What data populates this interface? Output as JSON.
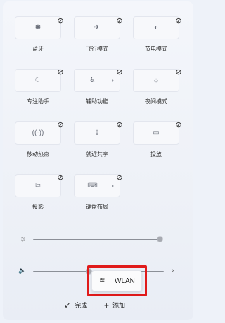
{
  "tiles": [
    {
      "label": "蓝牙",
      "icon": "bluetooth-icon",
      "glyph": "✱"
    },
    {
      "label": "飞行模式",
      "icon": "airplane-icon",
      "glyph": "✈"
    },
    {
      "label": "节电模式",
      "icon": "battery-saver-icon",
      "glyph": "◐"
    },
    {
      "label": "专注助手",
      "icon": "focus-assist-icon",
      "glyph": "☾"
    },
    {
      "label": "辅助功能",
      "icon": "accessibility-icon",
      "glyph": "♿",
      "chevron": "›"
    },
    {
      "label": "夜间模式",
      "icon": "night-light-icon",
      "glyph": "☼"
    },
    {
      "label": "移动热点",
      "icon": "hotspot-icon",
      "glyph": "((·))"
    },
    {
      "label": "就近共享",
      "icon": "nearby-share-icon",
      "glyph": "⇪"
    },
    {
      "label": "投放",
      "icon": "cast-icon",
      "glyph": "▭"
    },
    {
      "label": "投影",
      "icon": "project-icon",
      "glyph": "⧉"
    },
    {
      "label": "键盘布局",
      "icon": "keyboard-layout-icon",
      "glyph": "⌨",
      "chevron": "›"
    }
  ],
  "unpin_glyph": "⊘",
  "brightness": {
    "icon": "brightness-icon",
    "glyph": "☼",
    "level": 1.0
  },
  "volume": {
    "icon": "volume-icon",
    "glyph": "🔈",
    "chevron": "›",
    "level": 0.43
  },
  "wlan_chip": {
    "label": "WLAN",
    "icon": "wifi-icon",
    "glyph": "≋"
  },
  "footer": {
    "done_label": "完成",
    "done_icon": "✓",
    "add_label": "添加",
    "add_icon": "+"
  },
  "colors": {
    "highlight": "#e01a1a",
    "background": "#eef2f9"
  }
}
